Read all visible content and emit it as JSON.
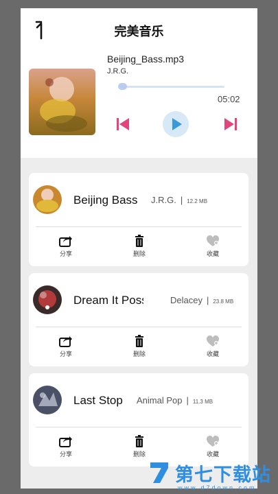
{
  "header": {
    "title": "完美音乐"
  },
  "player": {
    "track_name": "Beijing_Bass.mp3",
    "artist": "J.R.G.",
    "duration": "05:02",
    "progress_fraction": 0.02
  },
  "songs": [
    {
      "title": "Beijing Bass",
      "artist": "J.R.G.",
      "size": "12.2 MB"
    },
    {
      "title": "Dream It Possib",
      "artist": "Delacey",
      "size": "23.8 MB"
    },
    {
      "title": "Last Stop",
      "artist": "Animal Pop",
      "size": "11.3 MB"
    }
  ],
  "actions": {
    "share": "分享",
    "delete": "删除",
    "favorite": "收藏"
  },
  "watermark": {
    "text": "第七下载站",
    "url": "www.d7down.com"
  },
  "colors": {
    "accent": "#e0467c",
    "play_bg": "#d7e9f6",
    "play_icon": "#3a9ad9",
    "watermark": "#2f8ee0"
  }
}
